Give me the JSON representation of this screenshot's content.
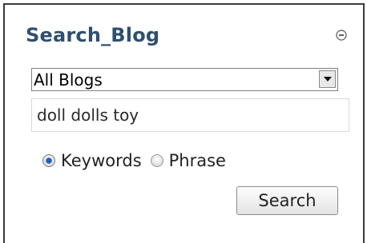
{
  "widget": {
    "title": "Search_Blog",
    "collapse_icon": "minus-circle-icon"
  },
  "blog_select": {
    "selected": "All Blogs",
    "arrow_icon": "dropdown-arrow-icon"
  },
  "search_input": {
    "value": "doll dolls toy"
  },
  "search_mode": {
    "options": [
      {
        "label": "Keywords",
        "checked": true
      },
      {
        "label": "Phrase",
        "checked": false
      }
    ]
  },
  "search_button": {
    "label": "Search"
  },
  "colors": {
    "title": "#2f4f6f",
    "border": "#3a3a3a",
    "radio_selected": "#1f5fbf"
  }
}
